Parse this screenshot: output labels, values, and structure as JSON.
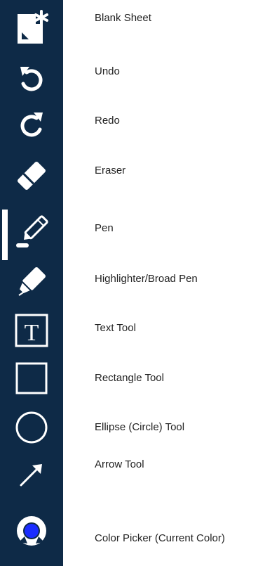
{
  "toolbar": {
    "background": "#0e2a47",
    "icon_color": "#ffffff",
    "active_tool": "Pen",
    "current_color": "#1a2cff",
    "tools": [
      {
        "icon": "blank-sheet-icon",
        "label": "Blank Sheet"
      },
      {
        "icon": "undo-icon",
        "label": "Undo"
      },
      {
        "icon": "redo-icon",
        "label": "Redo"
      },
      {
        "icon": "eraser-icon",
        "label": "Eraser"
      },
      {
        "icon": "pen-icon",
        "label": "Pen"
      },
      {
        "icon": "highlighter-icon",
        "label": "Highlighter/Broad Pen"
      },
      {
        "icon": "text-tool-icon",
        "label": "Text Tool"
      },
      {
        "icon": "rectangle-tool-icon",
        "label": "Rectangle Tool"
      },
      {
        "icon": "ellipse-tool-icon",
        "label": "Ellipse (Circle) Tool"
      },
      {
        "icon": "arrow-tool-icon",
        "label": "Arrow Tool"
      },
      {
        "icon": "color-picker-icon",
        "label": "Color Picker (Current Color)"
      }
    ]
  }
}
